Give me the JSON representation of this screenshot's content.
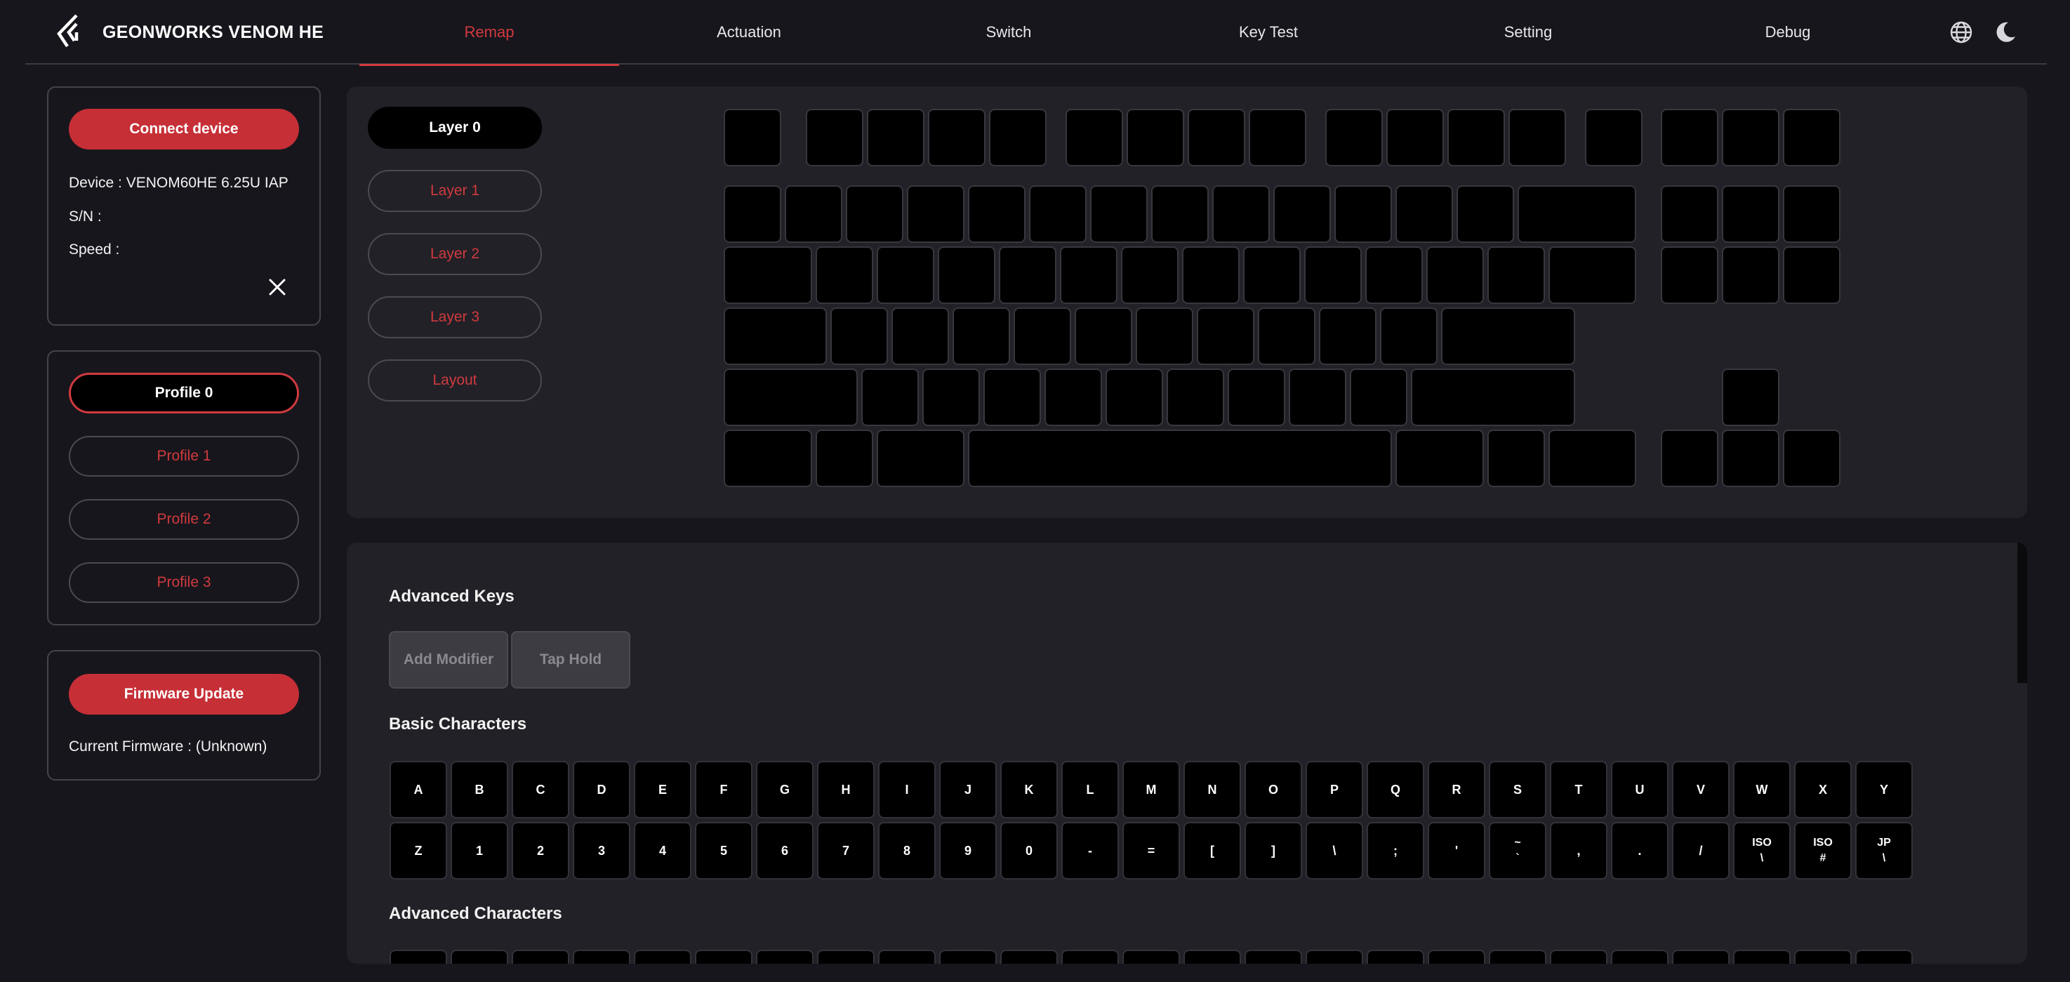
{
  "app": {
    "brand": "GEONWORKS VENOM HE"
  },
  "nav": {
    "tabs": [
      {
        "label": "Remap",
        "active": true
      },
      {
        "label": "Actuation",
        "active": false
      },
      {
        "label": "Switch",
        "active": false
      },
      {
        "label": "Key Test",
        "active": false
      },
      {
        "label": "Setting",
        "active": false
      },
      {
        "label": "Debug",
        "active": false
      }
    ]
  },
  "header_icons": {
    "language": "globe-icon",
    "theme": "moon-icon"
  },
  "device": {
    "connect_label": "Connect device",
    "device_line": "Device : VENOM60HE 6.25U IAP",
    "sn_line": "S/N :",
    "speed_line": "Speed :"
  },
  "profiles": [
    {
      "label": "Profile 0",
      "active": true
    },
    {
      "label": "Profile 1",
      "active": false
    },
    {
      "label": "Profile 2",
      "active": false
    },
    {
      "label": "Profile 3",
      "active": false
    }
  ],
  "firmware": {
    "update_label": "Firmware Update",
    "current_line": "Current Firmware : (Unknown)"
  },
  "layers": [
    {
      "label": "Layer 0",
      "active": true
    },
    {
      "label": "Layer 1",
      "active": false
    },
    {
      "label": "Layer 2",
      "active": false
    },
    {
      "label": "Layer 3",
      "active": false
    },
    {
      "label": "Layout",
      "active": false
    }
  ],
  "keycodes": {
    "advanced_title": "Advanced Keys",
    "advanced_buttons": [
      "Add Modifier",
      "Tap Hold"
    ],
    "basic_title": "Basic Characters",
    "basic_row1": [
      "A",
      "B",
      "C",
      "D",
      "E",
      "F",
      "G",
      "H",
      "I",
      "J",
      "K",
      "L",
      "M",
      "N",
      "O",
      "P",
      "Q",
      "R",
      "S",
      "T",
      "U",
      "V",
      "W",
      "X",
      "Y"
    ],
    "basic_row2": [
      "Z",
      "1",
      "2",
      "3",
      "4",
      "5",
      "6",
      "7",
      "8",
      "9",
      "0",
      "-",
      "=",
      "[",
      "]",
      "\\",
      ";",
      "'",
      "~\n`",
      ",",
      ".",
      "/",
      "ISO\n\\",
      "ISO\n#",
      "JP\n\\"
    ],
    "advanced_chars_title": "Advanced Characters"
  },
  "colors": {
    "accent": "#c62f36",
    "accent_text": "#d03a3f",
    "background": "#17161c",
    "panel": "#222127",
    "key": "#000000"
  }
}
